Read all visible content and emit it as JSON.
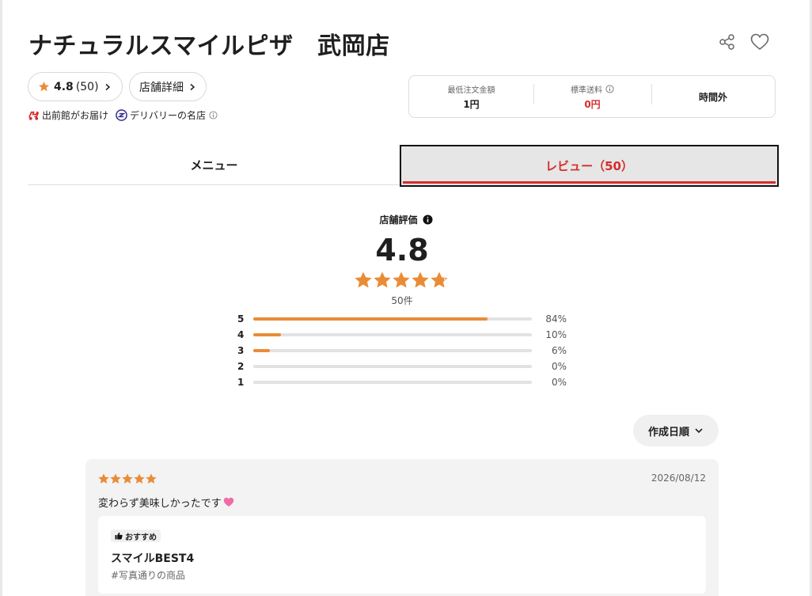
{
  "store": {
    "title": "ナチュラルスマイルピザ　武岡店"
  },
  "summary_pill": {
    "rating": "4.8",
    "count": "(50)"
  },
  "detail_pill": {
    "label": "店舗詳細"
  },
  "badges": {
    "delivery": "出前館がお届け",
    "famous": "デリバリーの名店"
  },
  "fees": {
    "min_order_label": "最低注文金額",
    "min_order_value": "1円",
    "shipping_label": "標準送料",
    "shipping_value": "0円",
    "hours": "時間外"
  },
  "tabs": {
    "menu": "メニュー",
    "review": "レビュー（50）"
  },
  "rating_summary": {
    "heading": "店舗評価",
    "score": "4.8",
    "stars": 4.8,
    "count": "50件",
    "distribution": [
      {
        "star": "5",
        "percent": 84,
        "label": "84%"
      },
      {
        "star": "4",
        "percent": 10,
        "label": "10%"
      },
      {
        "star": "3",
        "percent": 6,
        "label": "6%"
      },
      {
        "star": "2",
        "percent": 0,
        "label": "0%"
      },
      {
        "star": "1",
        "percent": 0,
        "label": "0%"
      }
    ]
  },
  "sort": {
    "label": "作成日順"
  },
  "review": {
    "stars": 5,
    "date": "2026/08/12",
    "text": "変わらず美味しかったです",
    "badge": "おすすめ",
    "item_name": "スマイルBEST4",
    "tag": "#写真通りの商品"
  },
  "colors": {
    "accent_red": "#d62c2c",
    "star_orange": "#ea8c36",
    "bar_track": "#e2e2e2"
  },
  "icons": {
    "share": "share-icon",
    "favorite": "heart-icon",
    "star": "star-icon",
    "chevron": "chevron-right-icon",
    "info": "info-icon",
    "thumbs_up": "thumbs-up-icon"
  }
}
